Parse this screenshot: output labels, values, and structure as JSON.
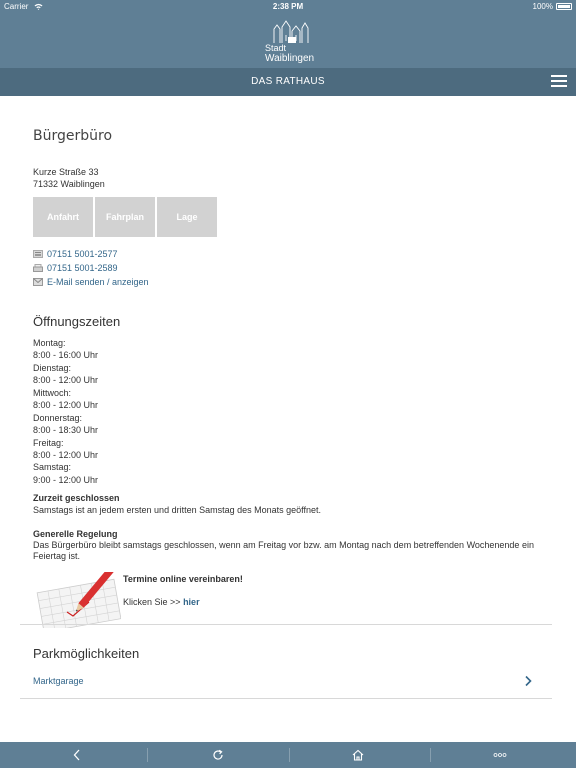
{
  "statusbar": {
    "carrier": "Carrier",
    "time": "2:38 PM",
    "battery": "100%"
  },
  "header": {
    "logo_line1": "Stadt",
    "logo_line2": "Waiblingen"
  },
  "nav": {
    "title": "DAS RATHAUS"
  },
  "office": {
    "title": "Bürgerbüro",
    "street": "Kurze Straße 33",
    "city": "71332 Waiblingen",
    "buttons": [
      "Anfahrt",
      "Fahrplan",
      "Lage"
    ],
    "phone": "07151 5001-2577",
    "fax": "07151 5001-2589",
    "email": "E-Mail senden / anzeigen"
  },
  "hours": {
    "title": "Öffnungszeiten",
    "days": [
      {
        "day": "Montag:",
        "time": "8:00 - 16:00 Uhr"
      },
      {
        "day": "Dienstag:",
        "time": "8:00 - 12:00 Uhr"
      },
      {
        "day": "Mittwoch:",
        "time": "8:00 - 12:00 Uhr"
      },
      {
        "day": "Donnerstag:",
        "time": "8:00 - 18:30 Uhr"
      },
      {
        "day": "Freitag:",
        "time": "8:00 - 12:00 Uhr"
      },
      {
        "day": "Samstag:",
        "time": "9:00 - 12:00 Uhr"
      }
    ],
    "notice_title": "Zurzeit geschlossen",
    "notice_text": "Samstags ist an jedem ersten und dritten Samstag des Monats geöffnet.",
    "rule_title": "Generelle Regelung",
    "rule_text": "Das Bürgerbüro bleibt samstags geschlossen, wenn am Freitag vor bzw. am Montag nach dem betreffenden Wochenende ein Feiertag ist."
  },
  "appointments": {
    "title": "Termine online vereinbaren!",
    "click_prefix": "Klicken Sie >>",
    "link": "hier"
  },
  "parking": {
    "title": "Parkmöglichkeiten",
    "item": "Marktgarage"
  },
  "bottom": {
    "icons": [
      "back-icon",
      "refresh-icon",
      "home-icon",
      "more-icon"
    ]
  }
}
